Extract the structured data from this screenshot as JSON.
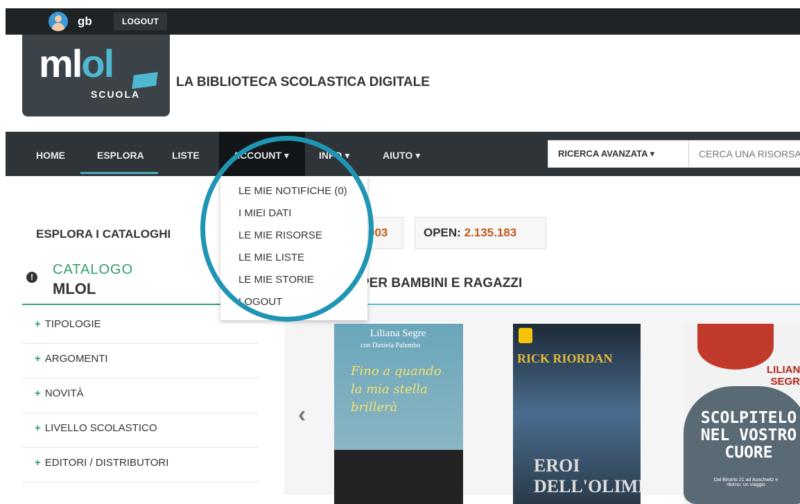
{
  "topbar": {
    "username": "gb",
    "logout_label": "LOGOUT"
  },
  "header": {
    "logo_text_main": "mlol",
    "logo_text_sub": "SCUOLA",
    "site_title": "LA BIBLIOTECA SCOLASTICA DIGITALE"
  },
  "nav": {
    "items": [
      {
        "label": "HOME"
      },
      {
        "label": "ESPLORA"
      },
      {
        "label": "LISTE"
      },
      {
        "label": "ACCOUNT ▾"
      },
      {
        "label": "INFO ▾"
      },
      {
        "label": "AIUTO ▾"
      }
    ],
    "search_mode": "RICERCA AVANZATA",
    "search_placeholder": "CERCA UNA RISORSA"
  },
  "account_menu": {
    "items": [
      {
        "label": "LE MIE NOTIFICHE (0)"
      },
      {
        "label": "I MIEI DATI"
      },
      {
        "label": "LE MIE RISORSE"
      },
      {
        "label": "LE MIE LISTE"
      },
      {
        "label": "LE MIE STORIE"
      },
      {
        "label": "LOGOUT"
      }
    ]
  },
  "catalog": {
    "explore_title": "ESPLORA I CATALOGHI",
    "mlol_count": "003",
    "open_label": "OPEN:",
    "open_count": "2.135.183",
    "catalog_label": "CATALOGO",
    "catalog_name": "MLOL"
  },
  "sidebar": {
    "items": [
      {
        "label": "TIPOLOGIE"
      },
      {
        "label": "ARGOMENTI"
      },
      {
        "label": "NOVITÀ"
      },
      {
        "label": "LIVELLO SCOLASTICO"
      },
      {
        "label": "EDITORI / DISTRIBUTORI"
      }
    ]
  },
  "section": {
    "title": "PER BAMBINI E RAGAZZI"
  },
  "books": [
    {
      "author": "Liliana Segre",
      "coauthor": "con Daniela Palumbo",
      "title": "Fino a quando la mia stella brillerà"
    },
    {
      "author": "RICK RIORDAN",
      "title": "EROI DELL'OLIMPO"
    },
    {
      "author": "LILIANA SEGRE",
      "title": "SCOLPITELO NEL VOSTRO CUORE",
      "subtitle": "Dal Binario 21 ad Auschwitz e ritorno: un viaggio"
    }
  ],
  "colors": {
    "accent": "#4fb8d1",
    "green": "#2fa06a",
    "highlight": "#1f95b4"
  }
}
